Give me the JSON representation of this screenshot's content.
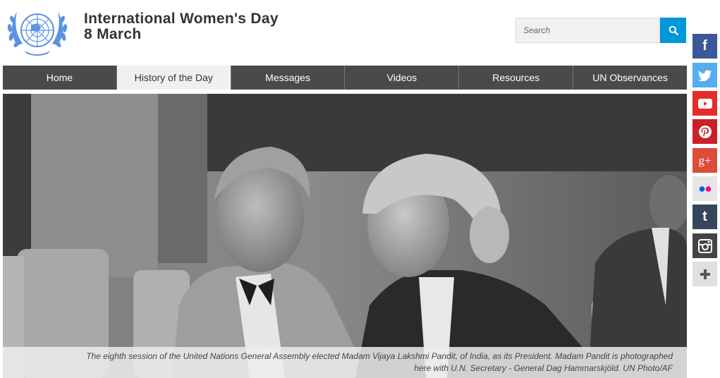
{
  "header": {
    "title_line1": "International Women's Day",
    "title_line2": "8 March",
    "logo_icon": "un-emblem-icon"
  },
  "search": {
    "placeholder": "Search",
    "button_icon": "search-icon"
  },
  "nav": {
    "tabs": [
      {
        "label": "Home",
        "active": false
      },
      {
        "label": "History of the Day",
        "active": true
      },
      {
        "label": "Messages",
        "active": false
      },
      {
        "label": "Videos",
        "active": false
      },
      {
        "label": "Resources",
        "active": false
      },
      {
        "label": "UN Observances",
        "active": false
      }
    ]
  },
  "hero": {
    "image_icon": "historical-photo",
    "caption_line1": "The eighth session of the United Nations General Assembly elected Madam Vijaya Lakshmi Pandit, of India, as its President. Madam Pandit is photographed",
    "caption_line2": "here with U.N. Secretary - General Dag Hammarskjöld. UN Photo/AF"
  },
  "social": [
    {
      "name": "facebook",
      "glyph": "f",
      "color": "#3b5998"
    },
    {
      "name": "twitter",
      "glyph": "",
      "color": "#55acee"
    },
    {
      "name": "youtube",
      "glyph": "",
      "color": "#e52d27"
    },
    {
      "name": "pinterest",
      "glyph": "",
      "color": "#cb2027"
    },
    {
      "name": "google-plus",
      "glyph": "g+",
      "color": "#dd4b39"
    },
    {
      "name": "flickr",
      "glyph": "",
      "color": "#e6e6e6"
    },
    {
      "name": "tumblr",
      "glyph": "t",
      "color": "#35465c"
    },
    {
      "name": "instagram",
      "glyph": "",
      "color": "#444444"
    },
    {
      "name": "more",
      "glyph": "+",
      "color": "#e0e0e0"
    }
  ],
  "colors": {
    "nav_bg": "#4a4a4a",
    "nav_active_bg": "#f0f0f0",
    "search_button": "#0098d8",
    "un_blue": "#5b92e5"
  }
}
